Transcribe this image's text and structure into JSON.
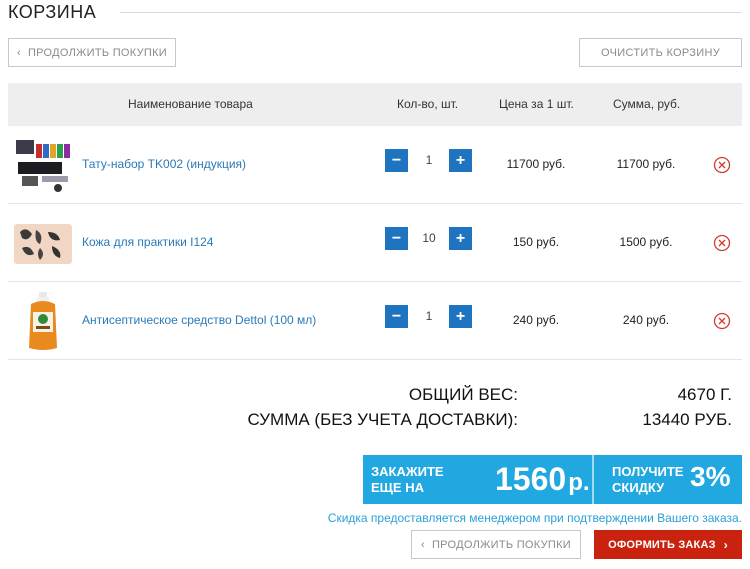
{
  "header": {
    "title": "Корзина"
  },
  "toolbar": {
    "continue_label": "Продолжить покупки",
    "clear_label": "Очистить корзину"
  },
  "table": {
    "columns": [
      "Наименование товара",
      "Кол-во, шт.",
      "Цена за 1 шт.",
      "Сумма, руб."
    ],
    "rows": [
      {
        "name": "Тату-набор TK002 (индукция)",
        "qty": "1",
        "price": "11700 руб.",
        "sum": "11700 руб.",
        "icon": "tattoo-kit-image"
      },
      {
        "name": "Кожа для практики I124",
        "qty": "10",
        "price": "150 руб.",
        "sum": "1500 руб.",
        "icon": "practice-skin-image"
      },
      {
        "name": "Антисептическое средство Dettol (100 мл)",
        "qty": "1",
        "price": "240 руб.",
        "sum": "240 руб.",
        "icon": "antiseptic-bottle-image"
      }
    ]
  },
  "totals": {
    "weight_label": "Общий вес:",
    "weight_value": "4670 г.",
    "sum_label": "Сумма (без учета доставки):",
    "sum_value": "13440 руб."
  },
  "promo": {
    "order_more_line1": "Закажите",
    "order_more_line2": "еще на",
    "amount": "1560",
    "amount_unit": "р.",
    "discount_line1": "Получите",
    "discount_line2": "скидку",
    "discount": "3%"
  },
  "note": "Скидка предоставляется менеджером при подтверждении Вашего заказа.",
  "footer": {
    "continue_label": "Продолжить покупки",
    "checkout_label": "Оформить заказ"
  },
  "colors": {
    "accent": "#21a8e0",
    "qty_button": "#1f74c0",
    "checkout": "#c9230f",
    "link": "#2a7ab8",
    "remove": "#d23a2a"
  }
}
